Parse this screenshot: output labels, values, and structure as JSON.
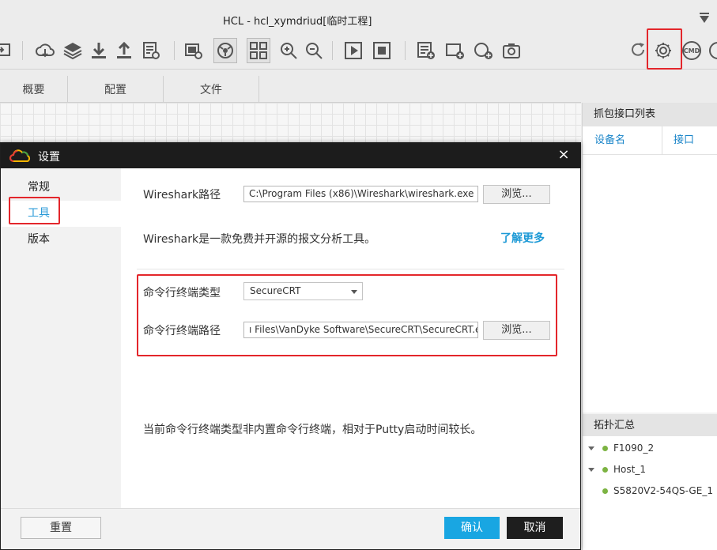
{
  "window": {
    "title": "HCL - hcl_xymdriud[临时工程]"
  },
  "toolbar": {
    "icons": [
      "import-icon",
      "cloud-download-icon",
      "layers-icon",
      "download-icon",
      "upload-icon",
      "report-icon",
      "screenshot-icon",
      "capture-icon",
      "grid-icon",
      "zoom-in-icon",
      "zoom-out-icon",
      "play-icon",
      "stop-icon",
      "add-text-icon",
      "add-rect-icon",
      "add-circle-icon",
      "camera-icon",
      "refresh-icon",
      "settings-icon",
      "cmd-icon",
      "help-icon"
    ],
    "cmd_label": "CMD",
    "highlight_color": "#e3262b"
  },
  "tabs": [
    "概要",
    "配置",
    "文件"
  ],
  "right_panel": {
    "capture_title": "抓包接口列表",
    "col_device": "设备名",
    "col_interface": "接口",
    "topology_title": "拓扑汇总",
    "topology": [
      {
        "name": "F1090_2",
        "expanded": true
      },
      {
        "name": "Host_1",
        "expanded": true
      },
      {
        "name": "S5820V2-54QS-GE_1",
        "expanded": false
      }
    ]
  },
  "dialog": {
    "title": "设置",
    "close": "×",
    "nav": [
      "常规",
      "工具",
      "版本"
    ],
    "active_nav": "工具",
    "wireshark_label": "Wireshark路径",
    "wireshark_path": "C:\\Program Files (x86)\\Wireshark\\wireshark.exe",
    "browse1": "浏览...",
    "wireshark_desc": "Wireshark是一款免费并开源的报文分析工具。",
    "learn_more": "了解更多",
    "term_type_label": "命令行终端类型",
    "term_type_value": "SecureCRT",
    "term_path_label": "命令行终端路径",
    "term_path": "ı Files\\VanDyke Software\\SecureCRT\\SecureCRT.exe",
    "browse2": "浏览...",
    "note": "当前命令行终端类型非内置命令行终端，相对于Putty启动时间较长。",
    "reset": "重置",
    "confirm": "确认",
    "cancel": "取消",
    "accent_color": "#19a6e2"
  }
}
